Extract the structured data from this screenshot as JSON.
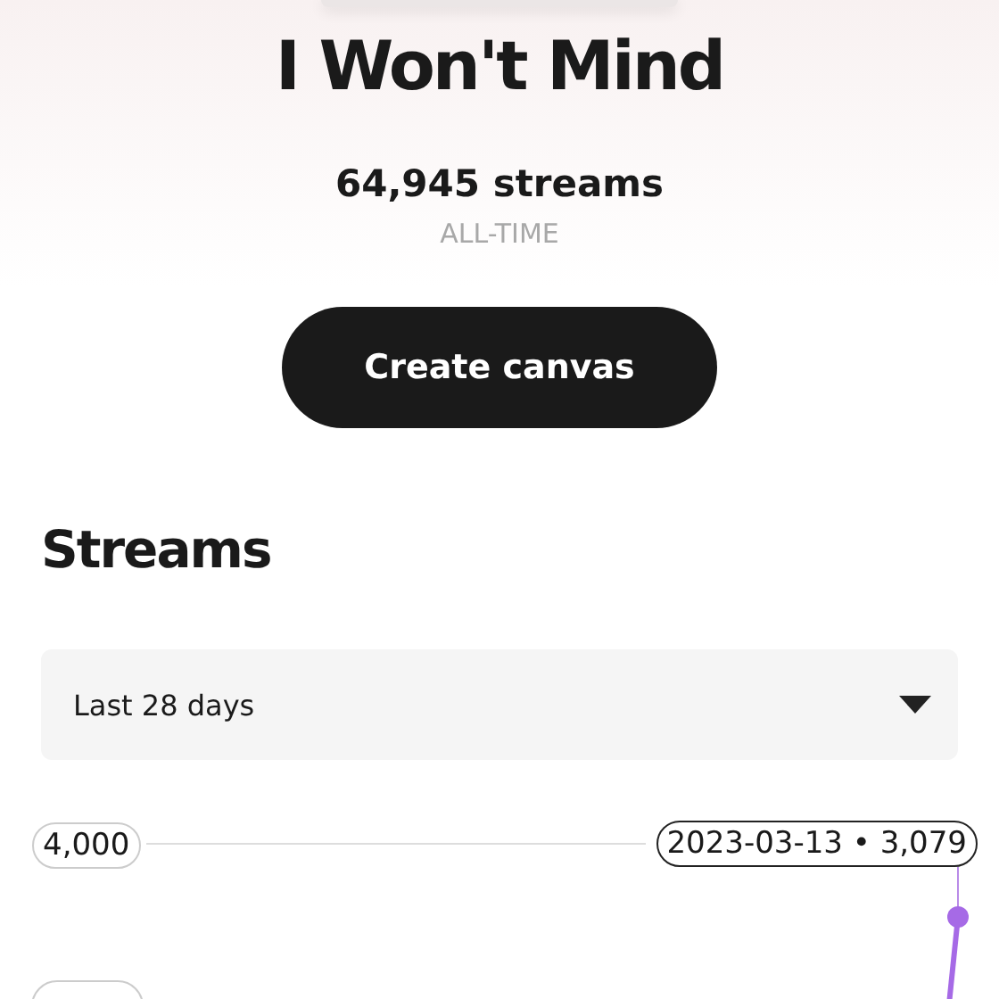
{
  "track": {
    "title": "I Won't Mind",
    "streams": "64,945 streams",
    "period": "ALL-TIME"
  },
  "create_button": {
    "label": "Create canvas"
  },
  "streams_section": {
    "heading": "Streams",
    "range_dropdown": {
      "value": "Last 28 days"
    },
    "chart": {
      "y_tick_label": "4,000",
      "tooltip": "2023-03-13 • 3,079"
    }
  }
}
